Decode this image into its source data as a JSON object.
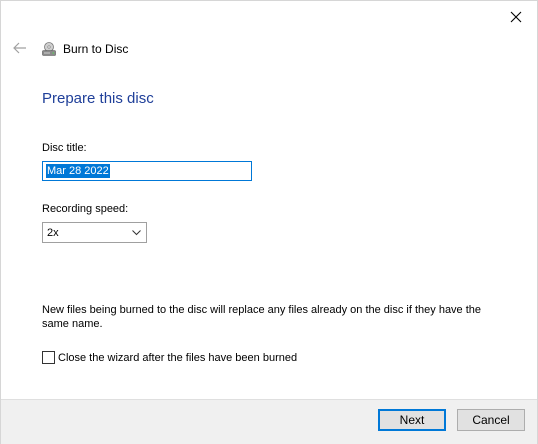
{
  "window": {
    "title": "Burn to Disc",
    "close_icon": "close-icon",
    "back_icon": "back-arrow-icon",
    "disc_icon": "disc-drive-icon"
  },
  "page": {
    "heading": "Prepare this disc",
    "disc_title_label": "Disc title:",
    "disc_title_value": "Mar 28 2022",
    "recording_speed_label": "Recording speed:",
    "recording_speed_value": "2x",
    "info_text": "New files being burned to the disc will replace any files already on the disc if they have the same name.",
    "close_wizard_label": "Close the wizard after the files have been burned",
    "close_wizard_checked": false
  },
  "footer": {
    "next_label": "Next",
    "cancel_label": "Cancel"
  },
  "colors": {
    "heading": "#1f3f99",
    "accent": "#0078d7",
    "footer_bg": "#f0f0f0"
  }
}
